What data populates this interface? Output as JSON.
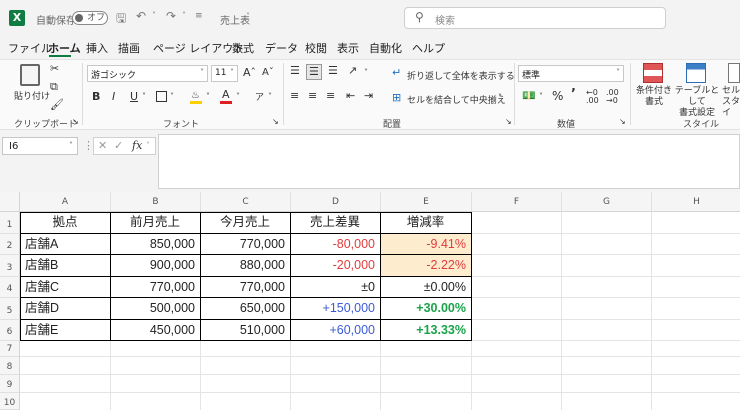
{
  "titlebar": {
    "app_icon": "X",
    "autosave_label": "自動保存",
    "autosave_state": "オフ",
    "filename": "売上表",
    "search_placeholder": "検索"
  },
  "menu": [
    "ファイル",
    "ホーム",
    "挿入",
    "描画",
    "ページ レイアウト",
    "数式",
    "データ",
    "校閲",
    "表示",
    "自動化",
    "ヘルプ"
  ],
  "ribbon": {
    "paste_label": "貼り付け",
    "clipboard_label": "クリップボード",
    "font_name": "游ゴシック",
    "font_size": "11",
    "font_label": "フォント",
    "wrap_text": "折り返して全体を表示する",
    "merge_center": "セルを結合して中央揃え",
    "alignment_label": "配置",
    "number_format": "標準",
    "number_label": "数値",
    "cond_format_1": "条件付き",
    "cond_format_2": "書式",
    "table_format_1": "テーブルとして",
    "table_format_2": "書式設定",
    "cell_style_1": "セル",
    "cell_style_2": "スタイ",
    "styles_label": "スタイル"
  },
  "formula_bar": {
    "name_box": "I6",
    "fx": "fx",
    "formula": ""
  },
  "sheet": {
    "columns": [
      "A",
      "B",
      "C",
      "D",
      "E",
      "F",
      "G",
      "H"
    ],
    "rows": [
      "1",
      "2",
      "3",
      "4",
      "5",
      "6",
      "7",
      "8",
      "9",
      "10"
    ],
    "header": [
      "拠点",
      "前月売上",
      "今月売上",
      "売上差異",
      "増減率"
    ],
    "data": [
      [
        "店舗A",
        "850,000",
        "770,000",
        "-80,000",
        "-9.41%"
      ],
      [
        "店舗B",
        "900,000",
        "880,000",
        "-20,000",
        "-2.22%"
      ],
      [
        "店舗C",
        "770,000",
        "770,000",
        "±0",
        "±0.00%"
      ],
      [
        "店舗D",
        "500,000",
        "650,000",
        "+150,000",
        "+30.00%"
      ],
      [
        "店舗E",
        "450,000",
        "510,000",
        "+60,000",
        "+13.33%"
      ]
    ]
  },
  "colors": {
    "excel_green": "#107c41",
    "negative": "#e03c3c",
    "positive_diff": "#3b5bd6",
    "positive_rate": "#1aa34a",
    "highlight": "#fdeccd"
  }
}
